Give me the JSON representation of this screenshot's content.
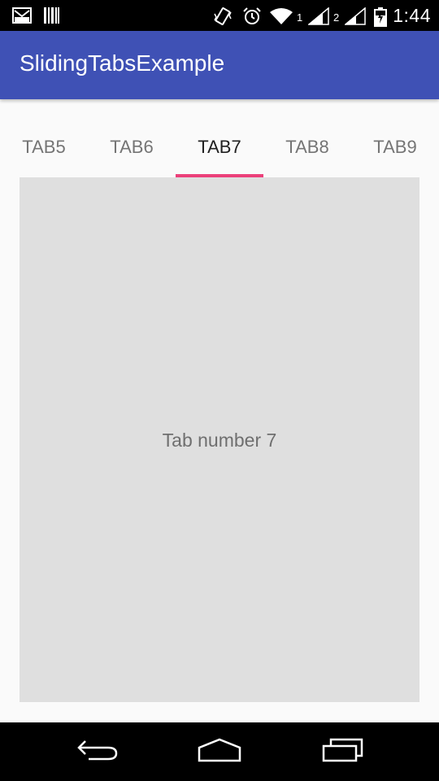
{
  "status_bar": {
    "time": "1:44",
    "sim1_label": "1",
    "sim2_label": "2",
    "icons": [
      "gmail-icon",
      "barcode-icon",
      "vibrate-icon",
      "alarm-icon",
      "wifi-icon",
      "signal-icon",
      "signal-icon",
      "battery-charging-icon"
    ]
  },
  "app_bar": {
    "title": "SlidingTabsExample",
    "color": "#3f51b5"
  },
  "tabs": {
    "items": [
      {
        "label": "TAB5"
      },
      {
        "label": "TAB6"
      },
      {
        "label": "TAB7"
      },
      {
        "label": "TAB8"
      },
      {
        "label": "TAB9"
      }
    ],
    "selected": "TAB7",
    "indicator_color": "#ec407a"
  },
  "content": {
    "text": "Tab number 7"
  },
  "nav_bar": {
    "icons": [
      "back-icon",
      "home-icon",
      "recents-icon"
    ]
  }
}
